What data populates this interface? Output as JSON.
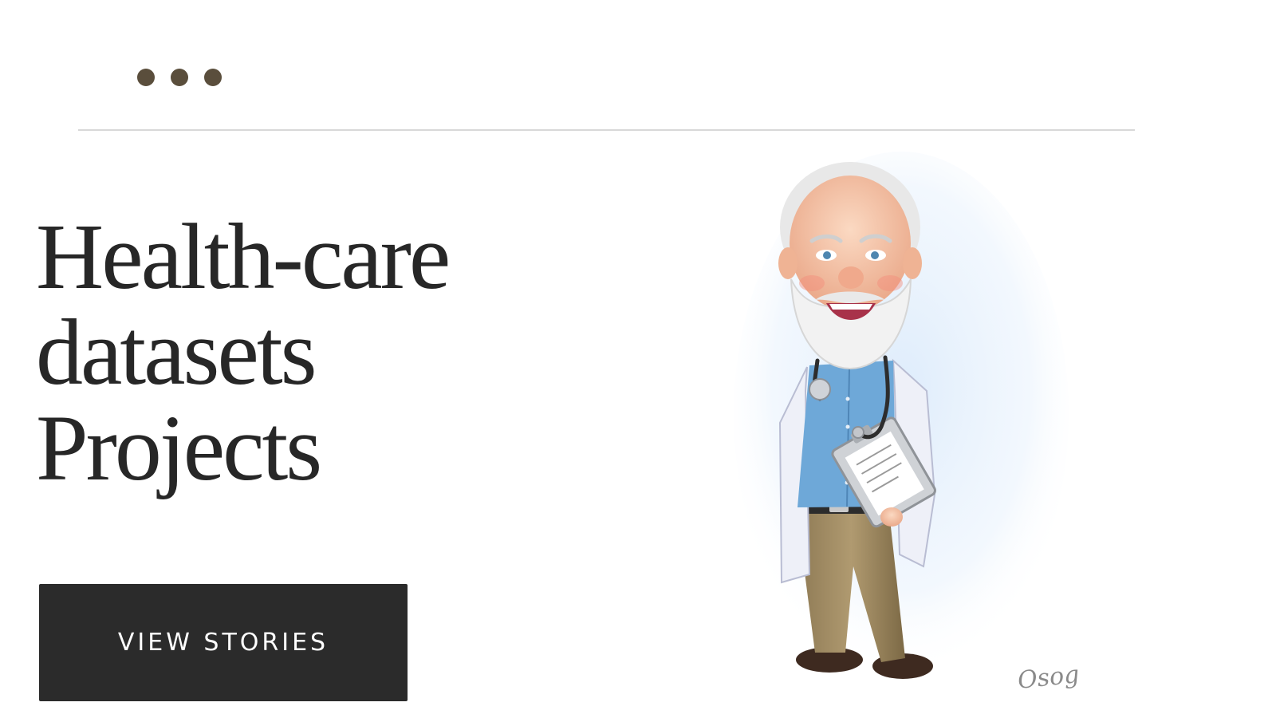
{
  "header": {
    "menu_icon": "more-horizontal-dots-icon",
    "menu_color": "#5a4e3c",
    "divider_color": "#d8d8d8"
  },
  "hero": {
    "title_lines": [
      "Health-care",
      "datasets",
      "Projects"
    ],
    "title_color": "#272727",
    "cta_label": "VIEW STORIES",
    "cta_background": "#2b2b2b",
    "cta_text_color": "#ffffff"
  },
  "illustration": {
    "subject": "doctor-caricature",
    "signature": "Osog"
  }
}
